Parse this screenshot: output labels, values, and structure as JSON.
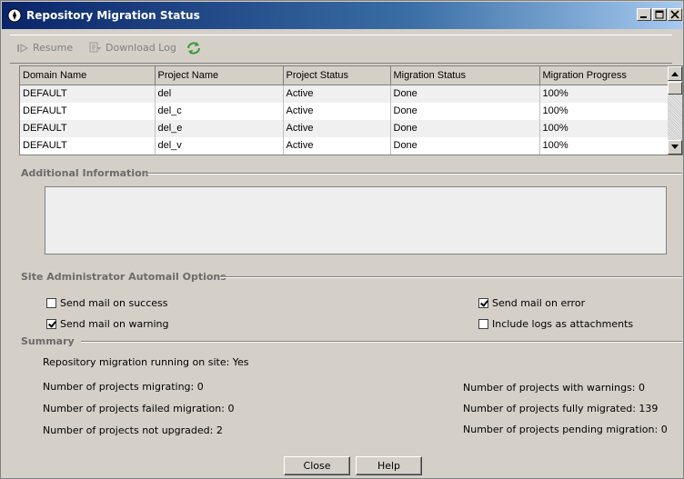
{
  "window": {
    "title": "Repository Migration Status"
  },
  "toolbar": {
    "resume_label": "Resume",
    "download_log_label": "Download Log"
  },
  "table": {
    "columns": [
      "Domain Name",
      "Project Name",
      "Project Status",
      "Migration Status",
      "Migration Progress"
    ],
    "rows": [
      [
        "DEFAULT",
        "del",
        "Active",
        "Done",
        "100%"
      ],
      [
        "DEFAULT",
        "del_c",
        "Active",
        "Done",
        "100%"
      ],
      [
        "DEFAULT",
        "del_e",
        "Active",
        "Done",
        "100%"
      ],
      [
        "DEFAULT",
        "del_v",
        "Active",
        "Done",
        "100%"
      ]
    ]
  },
  "additional": {
    "heading": "Additional Information",
    "text": ""
  },
  "automail": {
    "heading": "Site Administrator Automail Options",
    "success_label": "Send mail on success",
    "warning_label": "Send mail on warning",
    "error_label": "Send mail on error",
    "logs_label": "Include logs as attachments",
    "success_checked": false,
    "warning_checked": true,
    "error_checked": true,
    "logs_checked": false
  },
  "summary": {
    "heading": "Summary",
    "running": "Repository migration running on site:  Yes",
    "migrating": "Number of projects migrating:  0",
    "failed": "Number of projects failed migration:  0",
    "not_upgraded": "Number of projects not upgraded:  2",
    "warnings": "Number of projects with warnings:  0",
    "fully_migrated": "Number of projects fully migrated:  139",
    "pending": "Number of projects pending migration:  0"
  },
  "buttons": {
    "close_label": "Close",
    "help_label": "Help"
  }
}
